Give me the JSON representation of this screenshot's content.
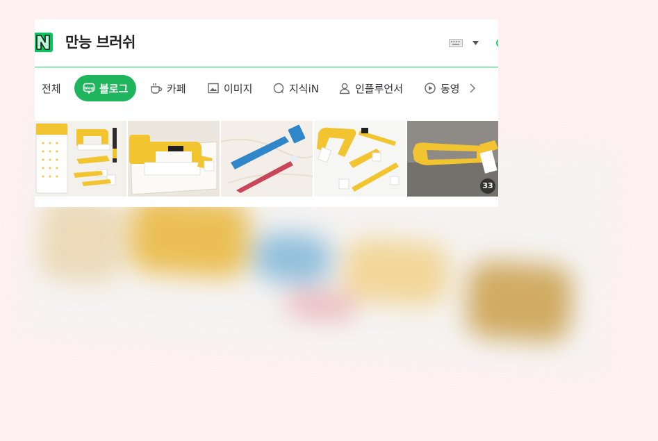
{
  "search": {
    "query": "만능 브러쉬"
  },
  "tabs": [
    {
      "label": "전체",
      "icon": "all-icon",
      "active": false
    },
    {
      "label": "블로그",
      "icon": "blog-icon",
      "active": true
    },
    {
      "label": "카페",
      "icon": "cafe-icon",
      "active": false
    },
    {
      "label": "이미지",
      "icon": "image-icon",
      "active": false
    },
    {
      "label": "지식iN",
      "icon": "kin-icon",
      "active": false
    },
    {
      "label": "인플루언서",
      "icon": "influencer-icon",
      "active": false
    },
    {
      "label": "동영",
      "icon": "video-icon",
      "active": false
    }
  ],
  "image_strip": {
    "more_count": "33"
  },
  "colors": {
    "brand_green": "#19ce60",
    "active_tab": "#1fb55c",
    "brush_yellow": "#f2c530",
    "page_bg": "#fff0f3"
  }
}
